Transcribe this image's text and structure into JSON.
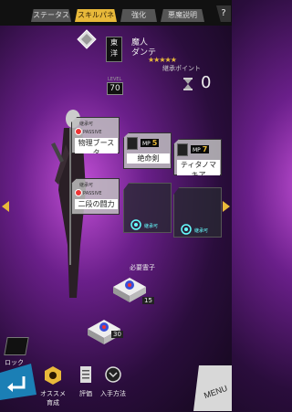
{
  "tabs": [
    {
      "label": "ステータス",
      "active": false
    },
    {
      "label": "スキルパネル",
      "active": true
    },
    {
      "label": "強化",
      "active": false
    },
    {
      "label": "悪魔説明",
      "active": false
    }
  ],
  "help_label": "?",
  "header": {
    "rarity_kanji": [
      "東",
      "洋"
    ],
    "level_label": "LEVEL",
    "level": "70",
    "class": "魔人",
    "name": "ダンテ",
    "stars": "★★★★★",
    "points_label": "継承ポイント",
    "points": "0"
  },
  "panels": [
    {
      "tag": "継承可",
      "type": "PASSIVE",
      "name": "物理ブースタ",
      "state": "unlocked"
    },
    {
      "mp": "5",
      "name": "絶命剣",
      "state": "unlocked"
    },
    {
      "mp": "7",
      "name": "ティタノマキア",
      "state": "unlocked"
    },
    {
      "tag": "継承可",
      "type": "PASSIVE",
      "name": "二段の闘力",
      "state": "unlocked"
    },
    {
      "lock_label": "継承可",
      "state": "locked"
    },
    {
      "lock_label": "継承可",
      "state": "locked"
    }
  ],
  "required": {
    "label": "必要霊子",
    "tile1_value": "15",
    "tile2_value": "30"
  },
  "bottom": {
    "lock_label": "ロック",
    "recommend_label": "オススメ育成",
    "review_label": "評価",
    "obtain_label": "入手方法",
    "menu_label": "MENU"
  },
  "colors": {
    "accent": "#e8b93a",
    "lock_cyan": "#66ffff"
  }
}
